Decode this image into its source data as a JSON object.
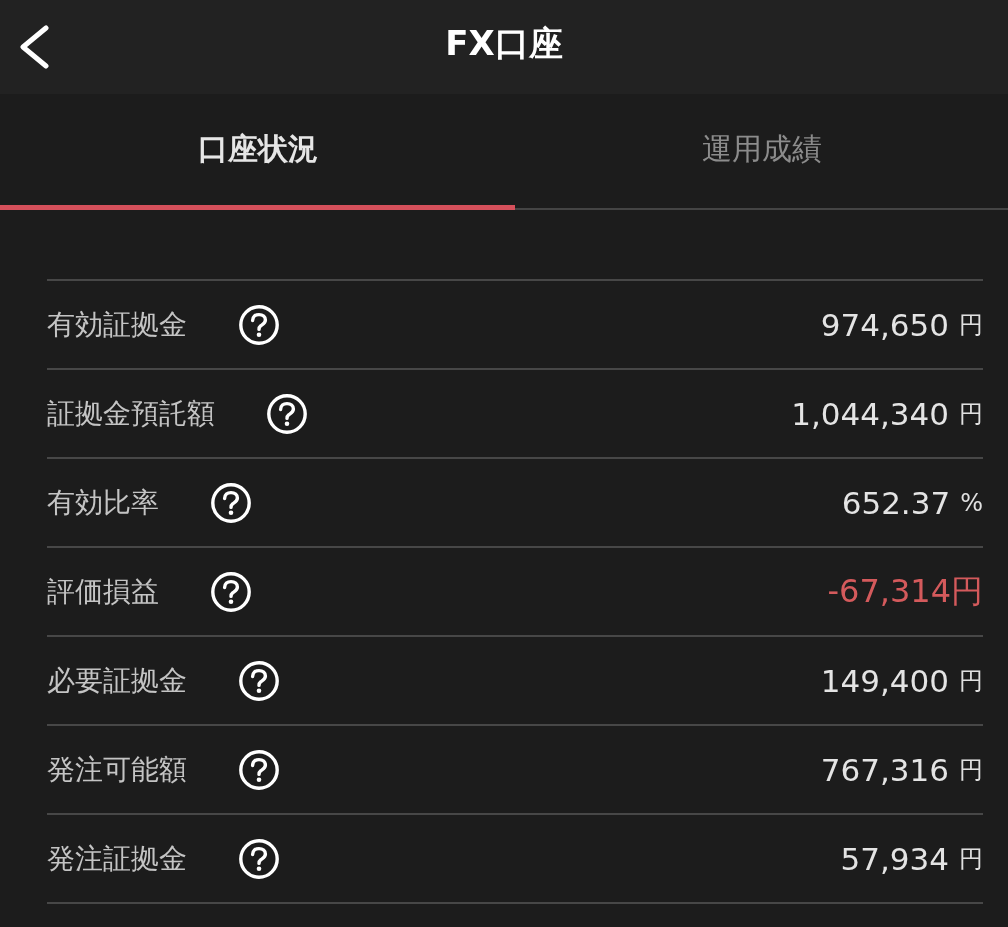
{
  "header": {
    "title": "FX口座"
  },
  "tabs": [
    {
      "label": "口座状況",
      "selected": true
    },
    {
      "label": "運用成績",
      "selected": false
    }
  ],
  "rows": [
    {
      "label": "有効証拠金",
      "value": "974,650",
      "unit": "円",
      "negative": false
    },
    {
      "label": "証拠金預託額",
      "value": "1,044,340",
      "unit": "円",
      "negative": false
    },
    {
      "label": "有効比率",
      "value": "652.37",
      "unit": "%",
      "negative": false
    },
    {
      "label": "評価損益",
      "value": "-67,314円",
      "negative": true
    },
    {
      "label": "必要証拠金",
      "value": "149,400",
      "unit": "円",
      "negative": false
    },
    {
      "label": "発注可能額",
      "value": "767,316",
      "unit": "円",
      "negative": false
    },
    {
      "label": "発注証拠金",
      "value": "57,934",
      "unit": "円",
      "negative": false
    }
  ]
}
